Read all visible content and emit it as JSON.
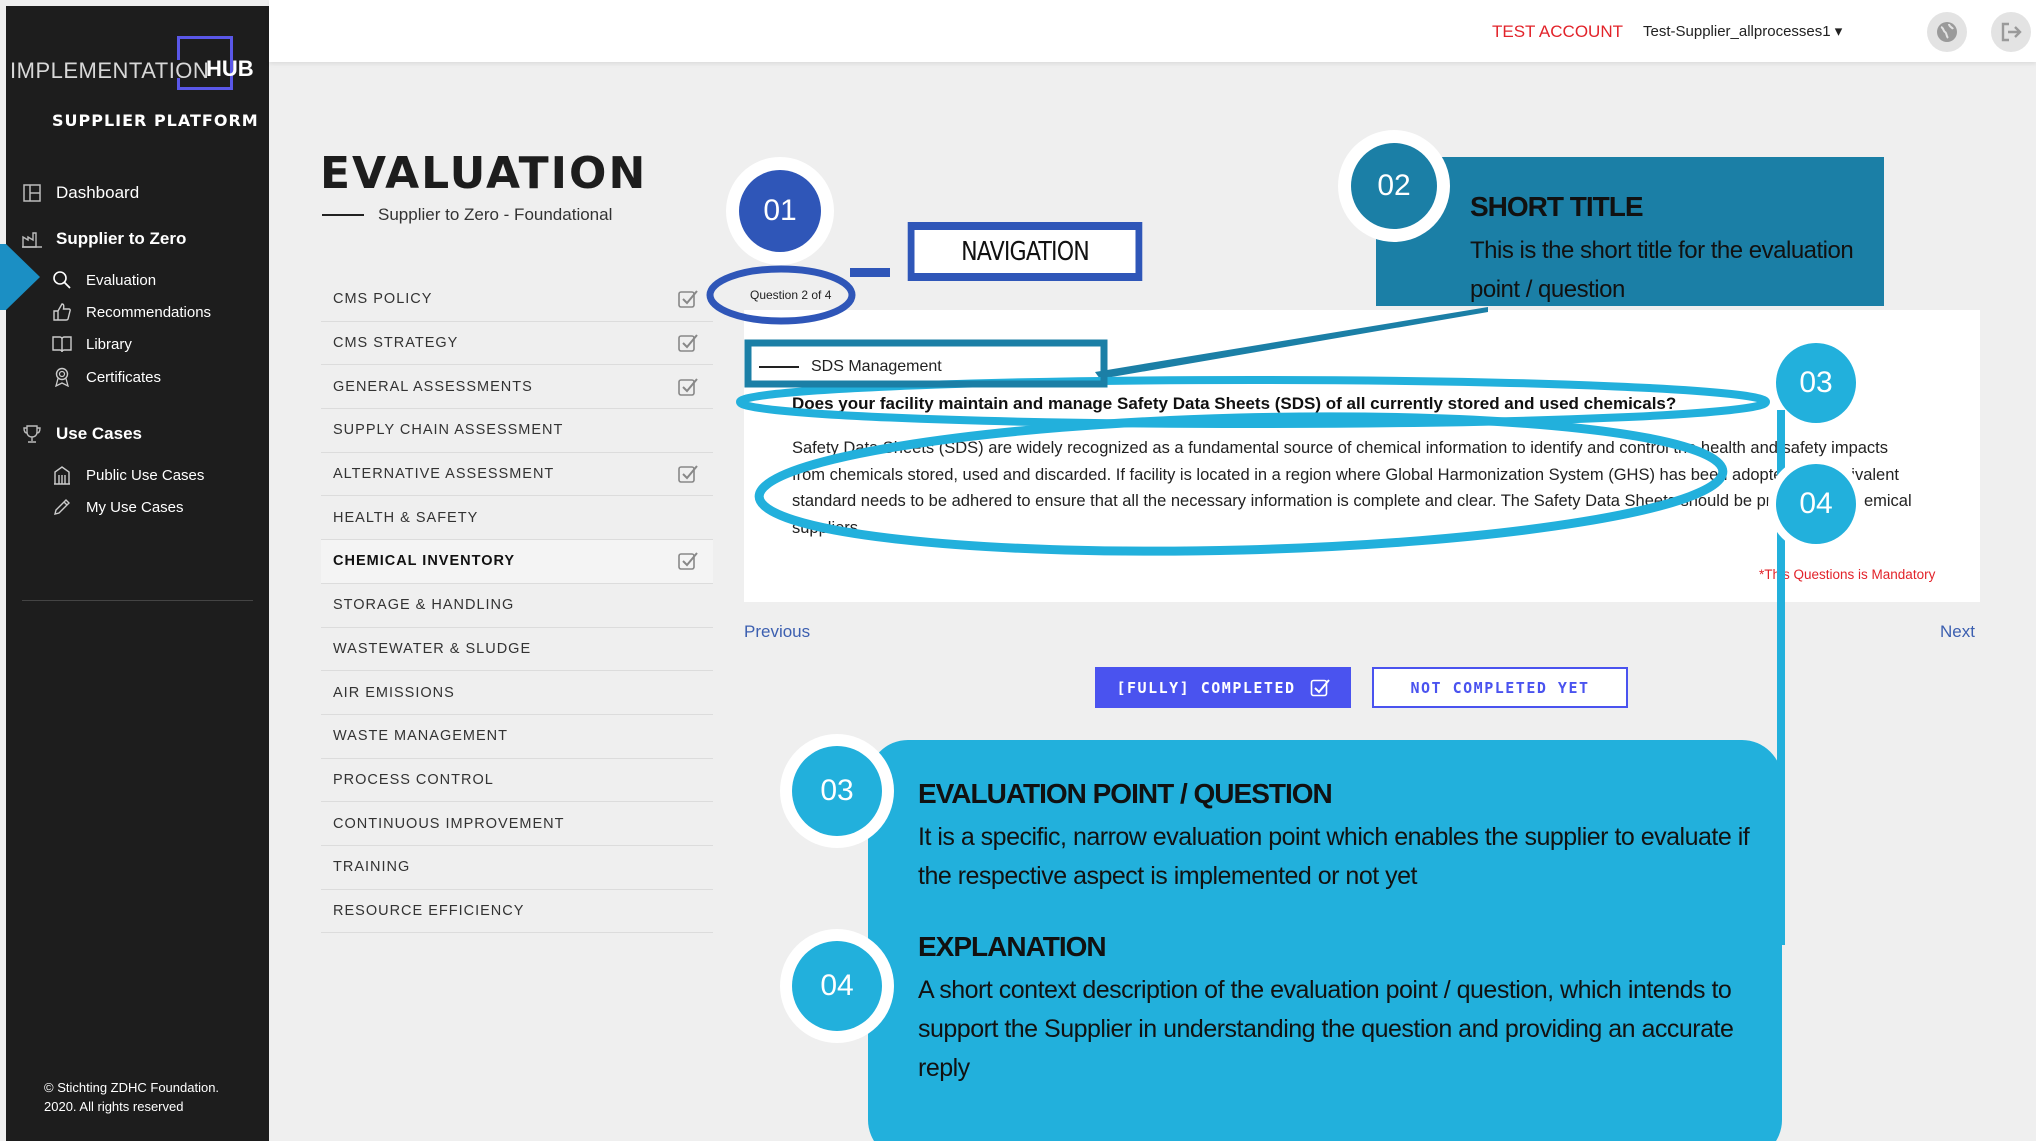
{
  "brand": {
    "name_part1": "IMPLEMENTATION",
    "name_part2": "HUB",
    "subtitle": "SUPPLIER PLATFORM"
  },
  "sidebar": {
    "items": [
      {
        "label": "Dashboard",
        "icon": "dashboard-icon"
      },
      {
        "label": "Supplier to Zero",
        "icon": "factory-icon",
        "children": [
          {
            "label": "Evaluation",
            "icon": "search-icon"
          },
          {
            "label": "Recommendations",
            "icon": "thumbs-up-icon"
          },
          {
            "label": "Library",
            "icon": "book-icon"
          },
          {
            "label": "Certificates",
            "icon": "badge-icon"
          }
        ]
      },
      {
        "label": "Use Cases",
        "icon": "trophy-icon",
        "children": [
          {
            "label": "Public Use Cases",
            "icon": "building-icon"
          },
          {
            "label": "My Use Cases",
            "icon": "pencil-icon"
          }
        ]
      }
    ],
    "copyright_line1": "© Stichting ZDHC Foundation.",
    "copyright_line2": "2020. All rights reserved"
  },
  "topbar": {
    "account_type": "TEST ACCOUNT",
    "account_name": "Test-Supplier_allprocesses1 ▾"
  },
  "page": {
    "title": "EVALUATION",
    "subtitle": "Supplier to Zero - Foundational"
  },
  "menu": [
    {
      "label": "CMS POLICY",
      "checked": true
    },
    {
      "label": "CMS STRATEGY",
      "checked": true
    },
    {
      "label": "GENERAL ASSESSMENTS",
      "checked": true
    },
    {
      "label": "SUPPLY CHAIN ASSESSMENT",
      "checked": false
    },
    {
      "label": "ALTERNATIVE ASSESSMENT",
      "checked": true
    },
    {
      "label": "HEALTH & SAFETY",
      "checked": false
    },
    {
      "label": "CHEMICAL INVENTORY",
      "checked": true,
      "active": true
    },
    {
      "label": "STORAGE & HANDLING",
      "checked": false
    },
    {
      "label": "WASTEWATER & SLUDGE",
      "checked": false
    },
    {
      "label": "AIR EMISSIONS",
      "checked": false
    },
    {
      "label": "WASTE MANAGEMENT",
      "checked": false
    },
    {
      "label": "PROCESS CONTROL",
      "checked": false
    },
    {
      "label": "CONTINUOUS IMPROVEMENT",
      "checked": false
    },
    {
      "label": "TRAINING",
      "checked": false
    },
    {
      "label": "RESOURCE EFFICIENCY",
      "checked": false
    }
  ],
  "question_card": {
    "counter": "Question 2 of 4",
    "short_title": "SDS Management",
    "question": "Does your facility maintain and manage Safety Data Sheets (SDS) of all currently stored and used chemicals?",
    "explanation": "Safety Data Sheets (SDS) are widely recognized as a fundamental source of chemical information to identify and control the health and safety impacts from chemicals stored, used and discarded. If facility is located in a region where Global Harmonization System (GHS) has been adopted, an equivalent standard needs to be adhered to ensure that all the necessary information is complete and clear. The Safety Data Sheets should be provided by chemical suppliers.",
    "mandatory_note": "*This Questions is Mandatory",
    "previous": "Previous",
    "next": "Next",
    "btn_completed": "[FULLY] COMPLETED",
    "btn_not_completed": "NOT COMPLETED YET"
  },
  "annotations": {
    "n01": "01",
    "n02": "02",
    "n03": "03",
    "n04": "04",
    "navigation": "NAVIGATION",
    "short_title_heading": "SHORT TITLE",
    "short_title_desc": "This is the short title for the evaluation point / question",
    "eval_heading": "EVALUATION POINT / QUESTION",
    "eval_desc": "It is a specific, narrow evaluation point which enables the supplier to evaluate if the respective aspect is implemented or not yet",
    "expl_heading": "EXPLANATION",
    "expl_desc": "A short context description of the evaluation point / question, which intends to support the Supplier in understanding the question and providing an accurate reply"
  },
  "colors": {
    "accent": "#4a53ef",
    "annotation_dark": "#1b7fa6",
    "annotation_light": "#22b0dc",
    "navy": "#2f56b8",
    "alert": "#e2232a"
  }
}
